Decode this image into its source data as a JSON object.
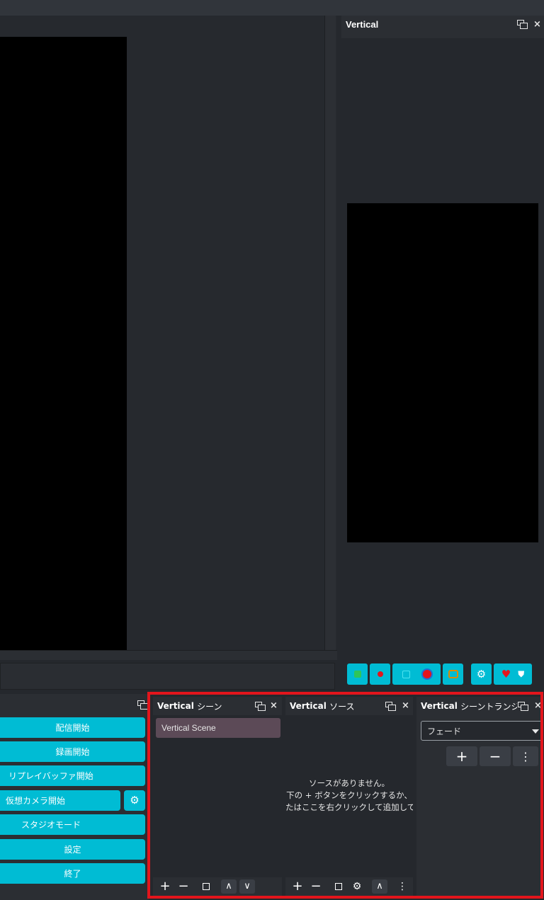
{
  "vertical_dock": {
    "title": "Vertical"
  },
  "vertical_toolbar": {
    "buttons": [
      "stream-icon",
      "record-icon",
      "virtualcam-icon",
      "replay-icon",
      "settings-icon",
      "heart-icon",
      "shield-icon"
    ]
  },
  "controls": {
    "start_streaming": "配信開始",
    "start_recording": "録画開始",
    "start_replay_buffer": "リプレイバッファ開始",
    "start_virtual_camera": "仮想カメラ開始",
    "studio_mode": "スタジオモード",
    "settings": "設定",
    "exit": "終了"
  },
  "scenes_panel": {
    "title_prefix": "Vertical",
    "title_suffix": "シーン",
    "items": [
      "Vertical Scene"
    ]
  },
  "sources_panel": {
    "title_prefix": "Vertical",
    "title_suffix": "ソース",
    "empty_line1": "ソースがありません。",
    "empty_line2": "下の + ボタンをクリックするか、",
    "empty_line3": "たはここを右クリックして追加してくださ"
  },
  "transitions_panel": {
    "title_prefix": "Vertical",
    "title_suffix": "シーントランジ...",
    "selected": "フェード"
  },
  "colors": {
    "accent": "#00bcd4",
    "highlight": "#e3151c",
    "scene_selected": "#5c4a57"
  }
}
